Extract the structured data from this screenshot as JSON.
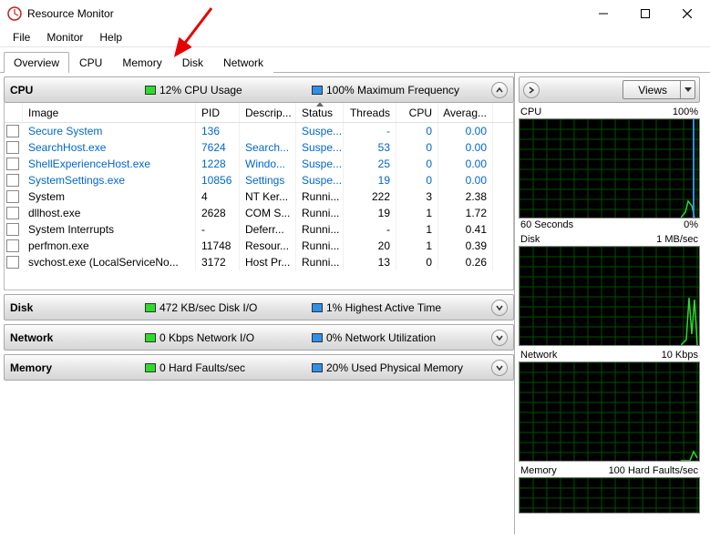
{
  "window": {
    "title": "Resource Monitor"
  },
  "menu": {
    "file": "File",
    "monitor": "Monitor",
    "help": "Help"
  },
  "tabs": {
    "overview": "Overview",
    "cpu": "CPU",
    "memory": "Memory",
    "disk": "Disk",
    "network": "Network"
  },
  "sections": {
    "cpu": {
      "name": "CPU",
      "stat1": "12% CPU Usage",
      "stat2": "100% Maximum Frequency"
    },
    "disk": {
      "name": "Disk",
      "stat1": "472 KB/sec Disk I/O",
      "stat2": "1% Highest Active Time"
    },
    "network": {
      "name": "Network",
      "stat1": "0 Kbps Network I/O",
      "stat2": "0% Network Utilization"
    },
    "memory": {
      "name": "Memory",
      "stat1": "0 Hard Faults/sec",
      "stat2": "20% Used Physical Memory"
    }
  },
  "columns": {
    "image": "Image",
    "pid": "PID",
    "desc": "Descrip...",
    "status": "Status",
    "threads": "Threads",
    "cpu": "CPU",
    "avg": "Averag..."
  },
  "rows": [
    {
      "image": "Secure System",
      "pid": "136",
      "desc": "",
      "status": "Suspe...",
      "threads": "-",
      "cpu": "0",
      "avg": "0.00",
      "link": true
    },
    {
      "image": "SearchHost.exe",
      "pid": "7624",
      "desc": "Search...",
      "status": "Suspe...",
      "threads": "53",
      "cpu": "0",
      "avg": "0.00",
      "link": true
    },
    {
      "image": "ShellExperienceHost.exe",
      "pid": "1228",
      "desc": "Windo...",
      "status": "Suspe...",
      "threads": "25",
      "cpu": "0",
      "avg": "0.00",
      "link": true
    },
    {
      "image": "SystemSettings.exe",
      "pid": "10856",
      "desc": "Settings",
      "status": "Suspe...",
      "threads": "19",
      "cpu": "0",
      "avg": "0.00",
      "link": true
    },
    {
      "image": "System",
      "pid": "4",
      "desc": "NT Ker...",
      "status": "Runni...",
      "threads": "222",
      "cpu": "3",
      "avg": "2.38",
      "link": false
    },
    {
      "image": "dllhost.exe",
      "pid": "2628",
      "desc": "COM S...",
      "status": "Runni...",
      "threads": "19",
      "cpu": "1",
      "avg": "1.72",
      "link": false
    },
    {
      "image": "System Interrupts",
      "pid": "-",
      "desc": "Deferr...",
      "status": "Runni...",
      "threads": "-",
      "cpu": "1",
      "avg": "0.41",
      "link": false
    },
    {
      "image": "perfmon.exe",
      "pid": "11748",
      "desc": "Resour...",
      "status": "Runni...",
      "threads": "20",
      "cpu": "1",
      "avg": "0.39",
      "link": false
    },
    {
      "image": "svchost.exe (LocalServiceNo...",
      "pid": "3172",
      "desc": "Host Pr...",
      "status": "Runni...",
      "threads": "13",
      "cpu": "0",
      "avg": "0.26",
      "link": false
    }
  ],
  "right": {
    "views": "Views",
    "cpu": {
      "title": "CPU",
      "scale": "100%",
      "xleft": "60 Seconds",
      "xright": "0%"
    },
    "disk": {
      "title": "Disk",
      "scale": "1 MB/sec"
    },
    "network": {
      "title": "Network",
      "scale": "10 Kbps"
    },
    "memory": {
      "title": "Memory",
      "scale": "100 Hard Faults/sec"
    }
  },
  "chart_data": [
    {
      "type": "line",
      "title": "CPU",
      "ylim": [
        0,
        100
      ],
      "x_seconds": 60,
      "series": [
        {
          "name": "CPU Usage",
          "color": "#2bdc2b",
          "values": [
            0,
            0,
            0,
            0,
            0,
            0,
            0,
            0,
            0,
            0,
            0,
            0,
            0,
            0,
            0,
            0,
            0,
            0,
            0,
            0,
            0,
            0,
            0,
            0,
            0,
            0,
            0,
            6,
            18,
            12
          ]
        },
        {
          "name": "Maximum Frequency",
          "color": "#3090e8",
          "values": [
            0,
            0,
            0,
            0,
            0,
            0,
            0,
            0,
            0,
            0,
            0,
            0,
            0,
            0,
            0,
            0,
            0,
            0,
            0,
            0,
            0,
            0,
            0,
            0,
            0,
            0,
            0,
            100,
            100,
            100
          ]
        }
      ]
    },
    {
      "type": "line",
      "title": "Disk",
      "ylabel": "KB/sec",
      "ylim": [
        0,
        1024
      ],
      "x_seconds": 60,
      "series": [
        {
          "name": "Disk I/O",
          "color": "#2bdc2b",
          "values": [
            0,
            0,
            0,
            0,
            0,
            0,
            0,
            0,
            0,
            0,
            0,
            0,
            0,
            0,
            0,
            0,
            0,
            0,
            0,
            0,
            0,
            0,
            0,
            0,
            0,
            0,
            0,
            60,
            500,
            472
          ]
        },
        {
          "name": "Highest Active Time %",
          "color": "#3090e8",
          "values": [
            0,
            0,
            0,
            0,
            0,
            0,
            0,
            0,
            0,
            0,
            0,
            0,
            0,
            0,
            0,
            0,
            0,
            0,
            0,
            0,
            0,
            0,
            0,
            0,
            0,
            0,
            0,
            2,
            4,
            1
          ]
        }
      ]
    },
    {
      "type": "line",
      "title": "Network",
      "ylabel": "Kbps",
      "ylim": [
        0,
        10
      ],
      "x_seconds": 60,
      "series": [
        {
          "name": "Network I/O",
          "color": "#2bdc2b",
          "values": [
            0,
            0,
            0,
            0,
            0,
            0,
            0,
            0,
            0,
            0,
            0,
            0,
            0,
            0,
            0,
            0,
            0,
            0,
            0,
            0,
            0,
            0,
            0,
            0,
            0,
            0,
            0,
            0,
            2,
            0
          ]
        },
        {
          "name": "Network Utilization %",
          "color": "#3090e8",
          "values": [
            0,
            0,
            0,
            0,
            0,
            0,
            0,
            0,
            0,
            0,
            0,
            0,
            0,
            0,
            0,
            0,
            0,
            0,
            0,
            0,
            0,
            0,
            0,
            0,
            0,
            0,
            0,
            0,
            0,
            0
          ]
        }
      ]
    },
    {
      "type": "line",
      "title": "Memory",
      "ylabel": "Hard Faults/sec",
      "ylim": [
        0,
        100
      ],
      "x_seconds": 60,
      "series": [
        {
          "name": "Hard Faults",
          "color": "#2bdc2b",
          "values": [
            0,
            0,
            0,
            0,
            0,
            0,
            0,
            0,
            0,
            0,
            0,
            0,
            0,
            0,
            0,
            0,
            0,
            0,
            0,
            0,
            0,
            0,
            0,
            0,
            0,
            0,
            0,
            0,
            0,
            0
          ]
        },
        {
          "name": "Used Physical Memory %",
          "color": "#3090e8",
          "values": [
            20,
            20,
            20,
            20,
            20,
            20,
            20,
            20,
            20,
            20,
            20,
            20,
            20,
            20,
            20,
            20,
            20,
            20,
            20,
            20,
            20,
            20,
            20,
            20,
            20,
            20,
            20,
            20,
            20,
            20
          ]
        }
      ]
    }
  ]
}
